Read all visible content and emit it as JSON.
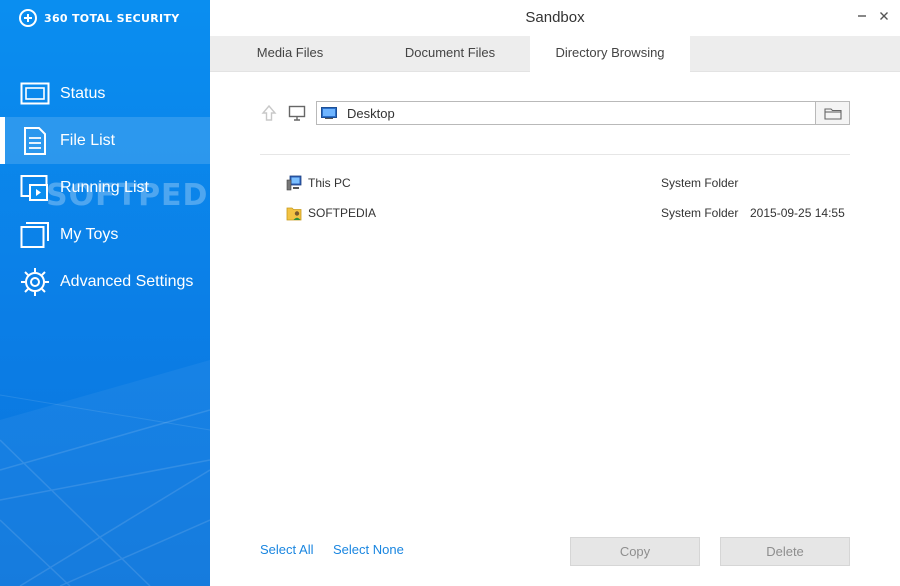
{
  "brand": {
    "name": "360 TOTAL SECURITY",
    "logo_icon": "plus-circle-logo"
  },
  "sidebar": {
    "items": [
      {
        "label": "Status",
        "icon": "monitor-screen-icon",
        "active": false
      },
      {
        "label": "File List",
        "icon": "document-list-icon",
        "active": true
      },
      {
        "label": "Running List",
        "icon": "running-window-icon",
        "active": false
      },
      {
        "label": "My Toys",
        "icon": "stacked-windows-icon",
        "active": false
      },
      {
        "label": "Advanced Settings",
        "icon": "gear-icon",
        "active": false
      }
    ],
    "watermark": "SOFTPEDIA"
  },
  "window": {
    "title": "Sandbox"
  },
  "tabs": [
    {
      "label": "Media Files",
      "active": false
    },
    {
      "label": "Document Files",
      "active": false
    },
    {
      "label": "Directory Browsing",
      "active": true
    }
  ],
  "path": {
    "value": "Desktop"
  },
  "files": [
    {
      "name": "This PC",
      "type": "System Folder",
      "date": "",
      "icon": "this-pc-icon"
    },
    {
      "name": "SOFTPEDIA",
      "type": "System Folder",
      "date": "2015-09-25 14:55",
      "icon": "user-folder-icon"
    }
  ],
  "footer": {
    "select_all": "Select All",
    "select_none": "Select None",
    "copy": "Copy",
    "delete": "Delete"
  },
  "colors": {
    "sidebar": "#0a8ef0",
    "link": "#1a86e0",
    "tab_bg": "#ededed"
  }
}
